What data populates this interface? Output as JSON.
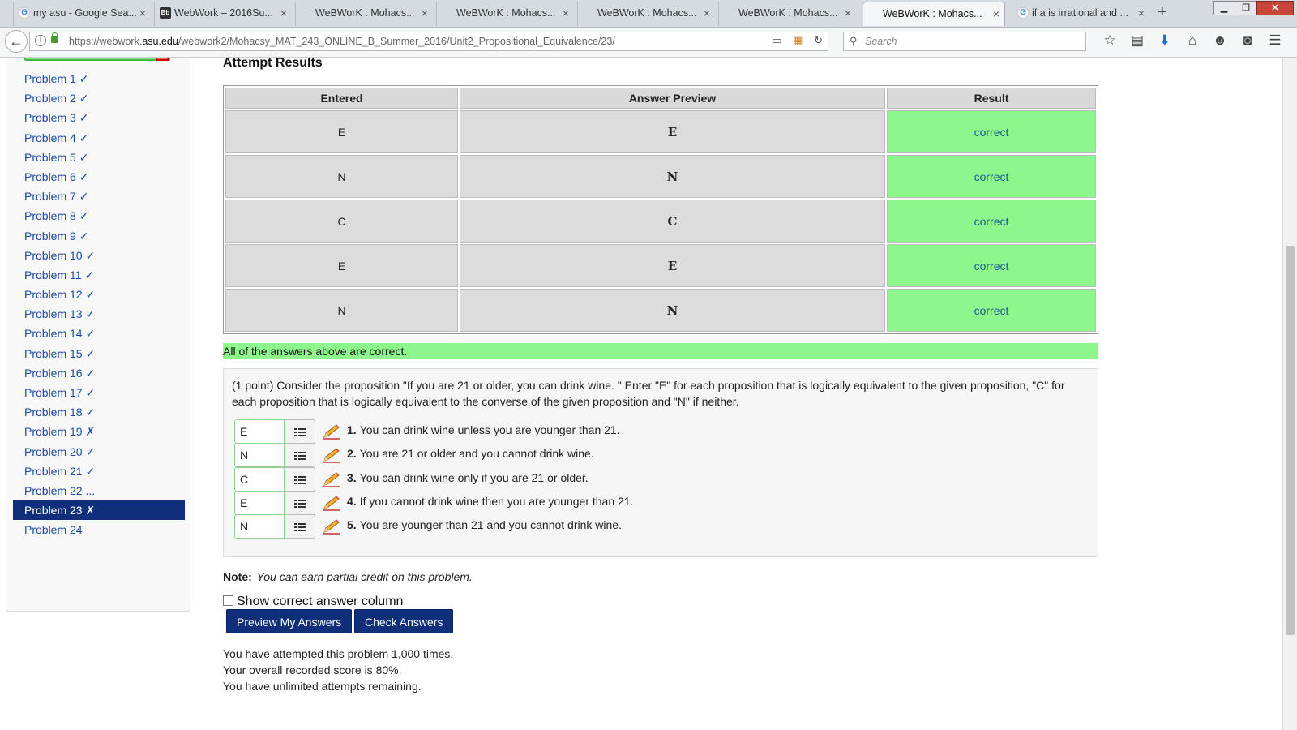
{
  "browser": {
    "tabs": [
      {
        "title": "my asu - Google Sea...",
        "icon": "google-icon"
      },
      {
        "title": "WebWork – 2016Su...",
        "icon": "blackboard-icon"
      },
      {
        "title": "WeBWorK : Mohacs...",
        "icon": ""
      },
      {
        "title": "WeBWorK : Mohacs...",
        "icon": ""
      },
      {
        "title": "WeBWorK : Mohacs...",
        "icon": ""
      },
      {
        "title": "WeBWorK : Mohacs...",
        "icon": ""
      },
      {
        "title": "WeBWorK : Mohacs...",
        "icon": "",
        "active": true
      },
      {
        "title": "if a is irrational and ...",
        "icon": "google-icon"
      }
    ],
    "url_prefix": "https://webwork.",
    "url_domain": "asu.edu",
    "url_rest": "/webwork2/Mohacsy_MAT_243_ONLINE_B_Summer_2016/Unit2_Propositional_Equivalence/23/",
    "search_placeholder": "Search"
  },
  "sidebar": {
    "problems": [
      {
        "label": "Problem 1 ✓"
      },
      {
        "label": "Problem 2 ✓"
      },
      {
        "label": "Problem 3 ✓"
      },
      {
        "label": "Problem 4 ✓"
      },
      {
        "label": "Problem 5 ✓"
      },
      {
        "label": "Problem 6 ✓"
      },
      {
        "label": "Problem 7 ✓"
      },
      {
        "label": "Problem 8 ✓"
      },
      {
        "label": "Problem 9 ✓"
      },
      {
        "label": "Problem 10 ✓"
      },
      {
        "label": "Problem 11 ✓"
      },
      {
        "label": "Problem 12 ✓"
      },
      {
        "label": "Problem 13 ✓"
      },
      {
        "label": "Problem 14 ✓"
      },
      {
        "label": "Problem 15 ✓"
      },
      {
        "label": "Problem 16 ✓"
      },
      {
        "label": "Problem 17 ✓"
      },
      {
        "label": "Problem 18 ✓"
      },
      {
        "label": "Problem 19 ✗"
      },
      {
        "label": "Problem 20 ✓"
      },
      {
        "label": "Problem 21 ✓"
      },
      {
        "label": "Problem 22 ..."
      },
      {
        "label": "Problem 23 ✗",
        "active": true
      },
      {
        "label": "Problem 24"
      }
    ]
  },
  "results": {
    "title": "Attempt Results",
    "headers": {
      "entered": "Entered",
      "preview": "Answer Preview",
      "result": "Result"
    },
    "rows": [
      {
        "entered": "E",
        "preview": "E",
        "result": "correct"
      },
      {
        "entered": "N",
        "preview": "N",
        "result": "correct"
      },
      {
        "entered": "C",
        "preview": "C",
        "result": "correct"
      },
      {
        "entered": "E",
        "preview": "E",
        "result": "correct"
      },
      {
        "entered": "N",
        "preview": "N",
        "result": "correct"
      }
    ],
    "summary": "All of the answers above are correct."
  },
  "problem": {
    "text": "(1 point) Consider the proposition \"If you are 21 or older, you can drink wine. \" Enter \"E\" for each proposition that is logically equivalent to the given proposition, \"C\" for each proposition that is logically equivalent to the converse of the given proposition and \"N\" if neither.",
    "answers": [
      {
        "value": "E",
        "num": "1.",
        "text": "You can drink wine unless you are younger than 21."
      },
      {
        "value": "N",
        "num": "2.",
        "text": "You are 21 or older and you cannot drink wine."
      },
      {
        "value": "C",
        "num": "3.",
        "text": "You can drink wine only if you are 21 or older."
      },
      {
        "value": "E",
        "num": "4.",
        "text": "If you cannot drink wine then you are younger than 21."
      },
      {
        "value": "N",
        "num": "5.",
        "text": "You are younger than 21 and you cannot drink wine."
      }
    ]
  },
  "note": {
    "label": "Note:",
    "text": "You can earn partial credit on this problem."
  },
  "controls": {
    "show_correct_label": "Show correct answer column",
    "preview_button": "Preview My Answers",
    "check_button": "Check Answers"
  },
  "status": {
    "attempts": "You have attempted this problem 1,000 times.",
    "score": "Your overall recorded score is 80%.",
    "remaining": "You have unlimited attempts remaining."
  },
  "colors": {
    "correct_bg": "#8df68d",
    "nav_active": "#0f2f7a",
    "link": "#1c4aa6"
  }
}
